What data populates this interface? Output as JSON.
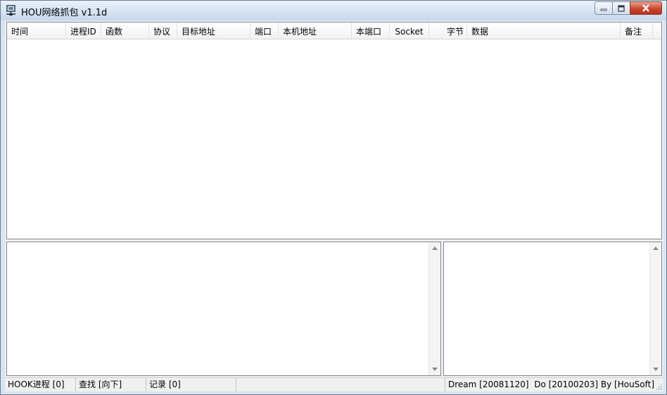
{
  "window": {
    "title": "HOU网络抓包 v1.1d",
    "icon": "network-computer-icon",
    "controls": {
      "minimize": "minimize-icon",
      "maximize": "maximize-icon",
      "close": "close-icon"
    }
  },
  "packet_list": {
    "columns": [
      {
        "label": "时间"
      },
      {
        "label": "进程ID"
      },
      {
        "label": "函数"
      },
      {
        "label": "协议"
      },
      {
        "label": "目标地址"
      },
      {
        "label": "端口"
      },
      {
        "label": "本机地址"
      },
      {
        "label": "本端口"
      },
      {
        "label": "Socket"
      },
      {
        "label": "字节"
      },
      {
        "label": "数据"
      },
      {
        "label": "备注"
      }
    ],
    "rows": []
  },
  "status_bar": {
    "hook": "HOOK进程 [0]",
    "find": "查找 [向下]",
    "records": "记录 [0]",
    "credits": "Dream [20081120]  Do [20100203] By [HouSoft]"
  }
}
